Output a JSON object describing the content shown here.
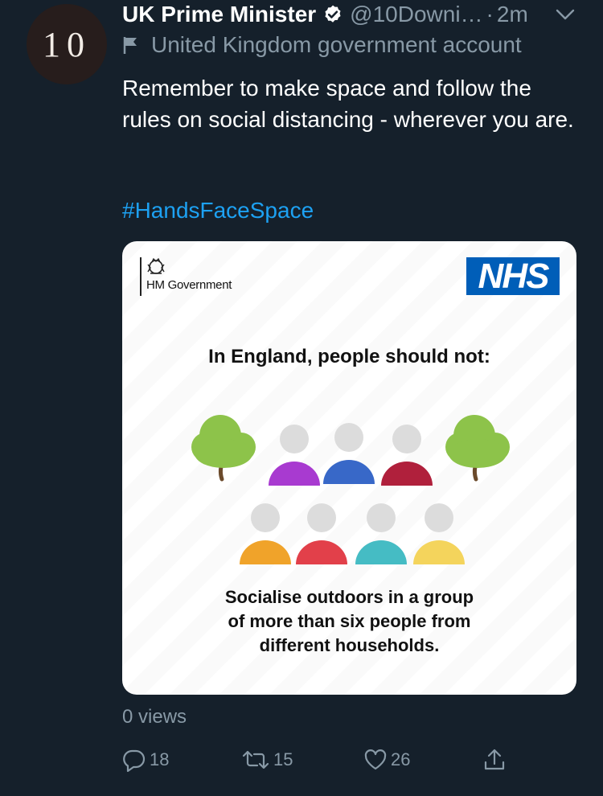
{
  "avatar": {
    "text": "10"
  },
  "tweet": {
    "display_name": "UK Prime Minister",
    "handle": "@10Downi…",
    "separator": "·",
    "time": "2m",
    "account_label": "United Kingdom government account",
    "text": "Remember to make space and follow the rules on social distancing - wherever you are.",
    "hashtag": "#HandsFaceSpace"
  },
  "media": {
    "gov_brand": "HM Government",
    "nhs_logo": "NHS",
    "heading": "In England, people should not:",
    "body_lines": [
      "Socialise outdoors in a group",
      "of more than six people from",
      "different households."
    ],
    "people_colors": [
      "#a83ad0",
      "#3868c8",
      "#b0203c",
      "#f0a32a",
      "#e2404a",
      "#45bcc4",
      "#f4d45c"
    ],
    "tree_color": "#8dc34a"
  },
  "stats": {
    "views": "0 views"
  },
  "actions": {
    "replies": "18",
    "retweets": "15",
    "likes": "26"
  },
  "colors": {
    "background": "#15202b",
    "secondary_text": "#8899a6",
    "link": "#1da1f2",
    "nhs_blue": "#005eb8"
  },
  "icons": {
    "verified": "verified-badge-icon",
    "chevron": "chevron-down-icon",
    "flag": "flag-icon",
    "reply": "reply-icon",
    "retweet": "retweet-icon",
    "like": "heart-icon",
    "share": "share-icon"
  }
}
